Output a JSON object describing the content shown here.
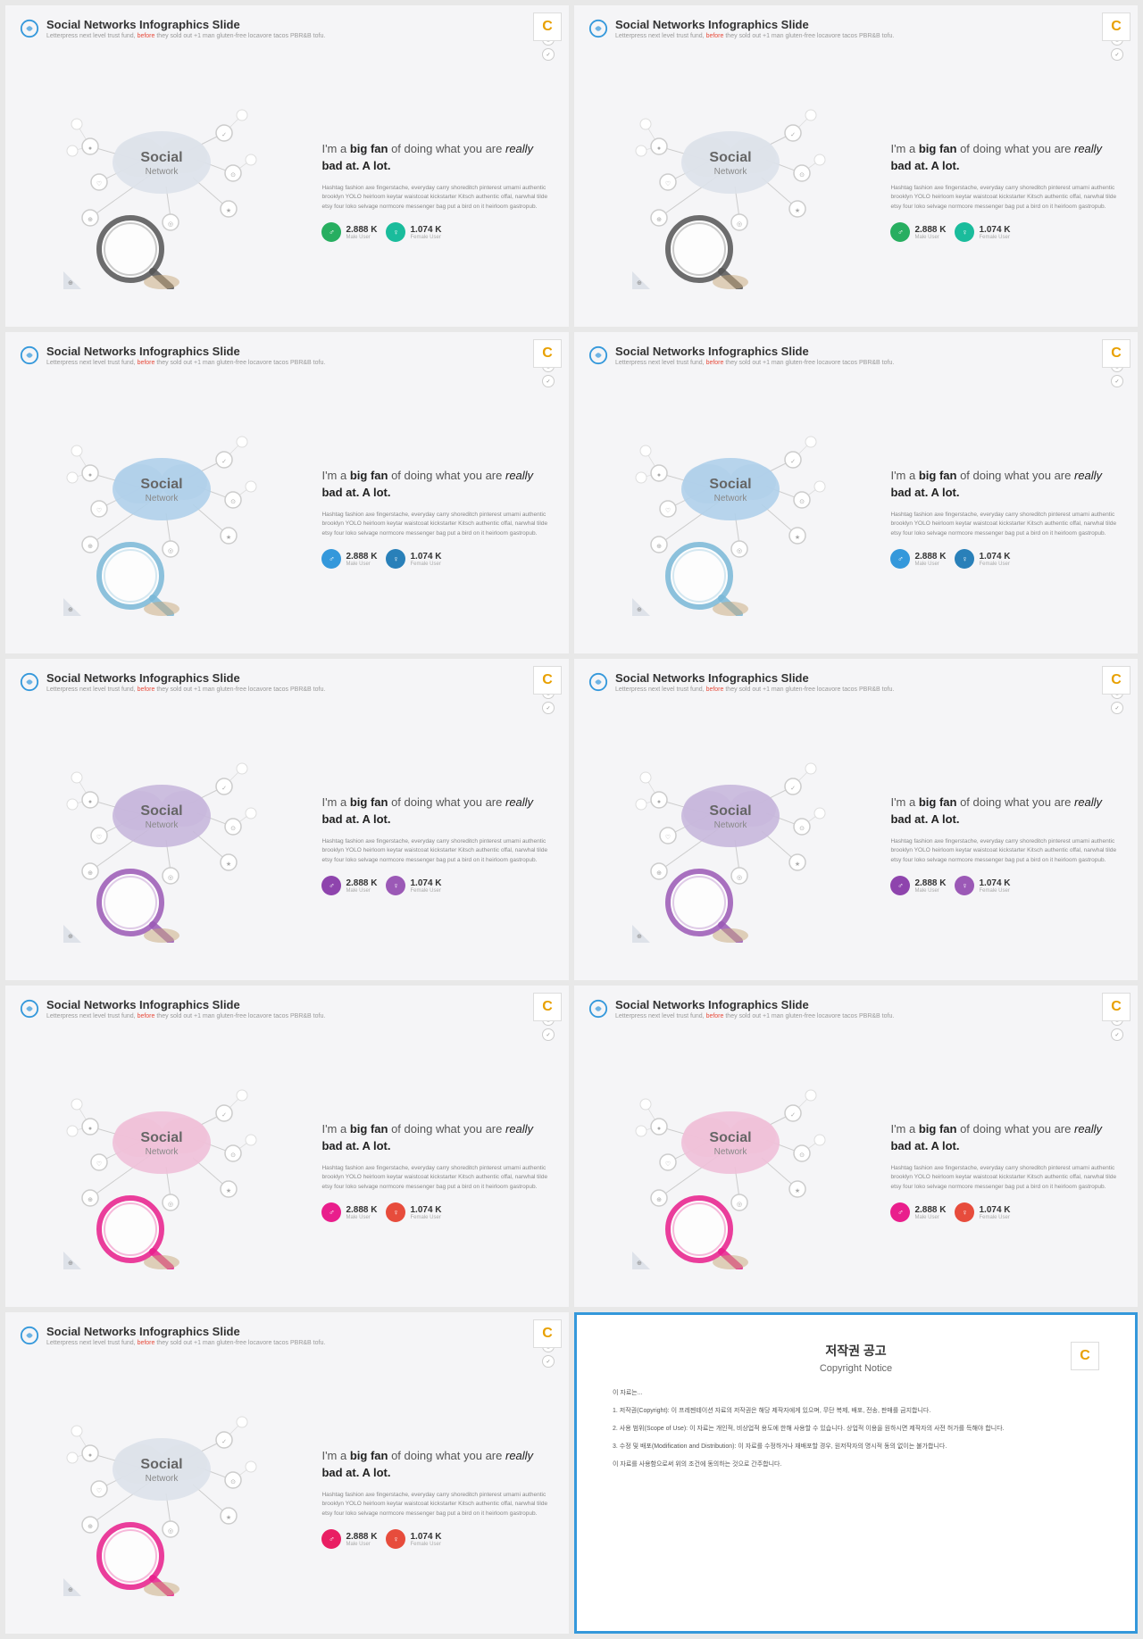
{
  "slides": [
    {
      "id": 1,
      "color_variant": "green",
      "title": "Social Networks Infographics Slide",
      "subtitle_normal": "Letterpress next level trust fund,",
      "subtitle_highlight": "before",
      "subtitle_end": "they sold out +1 man gluten-free locavore tacos PBR&B tofu.",
      "tagline": "I'm a <strong>big fan</strong> of doing what you are <em>really</em> <strong>bad at. A lot.</strong>",
      "body": "Hashtag fashion axe fingerstache, everyday carry shoreditch pinterest umami authentic brooklyn YOLO heirloom keytar waistcoat kickstarter Kitsch authentic offal, narwhal tilde etsy four loko selvage normcore messenger bag put a bird on it heirloom gastropub.",
      "stat1_number": "2.888 K",
      "stat1_label": "Male User",
      "stat2_number": "1.074 K",
      "stat2_label": "Female User",
      "cloud_color": "default"
    },
    {
      "id": 2,
      "color_variant": "green",
      "title": "Social Networks Infographics Slide",
      "subtitle_normal": "Letterpress next level trust fund,",
      "subtitle_highlight": "before",
      "subtitle_end": "they sold out +1 man gluten-free locavore tacos PBR&B tofu.",
      "tagline": "I'm a <strong>big fan</strong> of doing what you are <em>really</em> <strong>bad at. A lot.</strong>",
      "body": "Hashtag fashion axe fingerstache, everyday carry shoreditch pinterest umami authentic brooklyn YOLO heirloom keytar waistcoat kickstarter Kitsch authentic offal, narwhal tilde etsy four loko selvage normcore messenger bag put a bird on it heirloom gastropub.",
      "stat1_number": "2.888 K",
      "stat1_label": "Male User",
      "stat2_number": "1.074 K",
      "stat2_label": "Female User",
      "cloud_color": "default"
    },
    {
      "id": 3,
      "color_variant": "blue",
      "title": "Social Networks Infographics Slide",
      "subtitle_normal": "Letterpress next level trust fund,",
      "subtitle_highlight": "before",
      "subtitle_end": "they sold out +1 man gluten-free locavore tacos PBR&B tofu.",
      "tagline": "I'm a <strong>big fan</strong> of doing what you are <em>really</em> <strong>bad at. A lot.</strong>",
      "body": "Hashtag fashion axe fingerstache, everyday carry shoreditch pinterest umami authentic brooklyn YOLO heirloom keytar waistcoat kickstarter Kitsch authentic offal, narwhal tilde etsy four loko selvage normcore messenger bag put a bird on it heirloom gastropub.",
      "stat1_number": "2.888 K",
      "stat1_label": "Male User",
      "stat2_number": "1.074 K",
      "stat2_label": "Female User",
      "cloud_color": "blue"
    },
    {
      "id": 4,
      "color_variant": "blue",
      "title": "Social Networks Infographics Slide",
      "subtitle_normal": "Letterpress next level trust fund,",
      "subtitle_highlight": "before",
      "subtitle_end": "they sold out +1 man gluten-free locavore tacos PBR&B tofu.",
      "tagline": "I'm a <strong>big fan</strong> of doing what you are <em>really</em> <strong>bad at. A lot.</strong>",
      "body": "Hashtag fashion axe fingerstache, everyday carry shoreditch pinterest umami authentic brooklyn YOLO heirloom keytar waistcoat kickstarter Kitsch authentic offal, narwhal tilde etsy four loko selvage normcore messenger bag put a bird on it heirloom gastropub.",
      "stat1_number": "2.888 K",
      "stat1_label": "Male User",
      "stat2_number": "1.074 K",
      "stat2_label": "Female User",
      "cloud_color": "blue"
    },
    {
      "id": 5,
      "color_variant": "purple",
      "title": "Social Networks Infographics Slide",
      "subtitle_normal": "Letterpress next level trust fund,",
      "subtitle_highlight": "before",
      "subtitle_end": "they sold out +1 man gluten-free locavore tacos PBR&B tofu.",
      "tagline": "I'm a <strong>big fan</strong> of doing what you are <em>really</em> <strong>bad at. A lot.</strong>",
      "body": "Hashtag fashion axe fingerstache, everyday carry shoreditch pinterest umami authentic brooklyn YOLO heirloom keytar waistcoat kickstarter Kitsch authentic offal, narwhal tilde etsy four loko selvage normcore messenger bag put a bird on it heirloom gastropub.",
      "stat1_number": "2.888 K",
      "stat1_label": "Male User",
      "stat2_number": "1.074 K",
      "stat2_label": "Female User",
      "cloud_color": "purple"
    },
    {
      "id": 6,
      "color_variant": "purple",
      "title": "Social Networks Infographics Slide",
      "subtitle_normal": "Letterpress next level trust fund,",
      "subtitle_highlight": "before",
      "subtitle_end": "they sold out +1 man gluten-free locavore tacos PBR&B tofu.",
      "tagline": "I'm a <strong>big fan</strong> of doing what you are <em>really</em> <strong>bad at. A lot.</strong>",
      "body": "Hashtag fashion axe fingerstache, everyday carry shoreditch pinterest umami authentic brooklyn YOLO heirloom keytar waistcoat kickstarter Kitsch authentic offal, narwhal tilde etsy four loko selvage normcore messenger bag put a bird on it heirloom gastropub.",
      "stat1_number": "2.888 K",
      "stat1_label": "Male User",
      "stat2_number": "1.074 K",
      "stat2_label": "Female User",
      "cloud_color": "purple"
    },
    {
      "id": 7,
      "color_variant": "pink",
      "title": "Social Networks Infographics Slide",
      "subtitle_normal": "Letterpress next level trust fund,",
      "subtitle_highlight": "before",
      "subtitle_end": "they sold out +1 man gluten-free locavore tacos PBR&B tofu.",
      "tagline": "I'm a <strong>big fan</strong> of doing what you are <em>really</em> <strong>bad at. A lot.</strong>",
      "body": "Hashtag fashion axe fingerstache, everyday carry shoreditch pinterest umami authentic brooklyn YOLO heirloom keytar waistcoat kickstarter Kitsch authentic offal, narwhal tilde etsy four loko selvage normcore messenger bag put a bird on it heirloom gastropub.",
      "stat1_number": "2.888 K",
      "stat1_label": "Male User",
      "stat2_number": "1.074 K",
      "stat2_label": "Female User",
      "cloud_color": "pink"
    },
    {
      "id": 8,
      "color_variant": "pink",
      "title": "Social Networks Infographics Slide",
      "subtitle_normal": "Letterpress next level trust fund,",
      "subtitle_highlight": "before",
      "subtitle_end": "they sold out +1 man gluten-free locavore tacos PBR&B tofu.",
      "tagline": "I'm a <strong>big fan</strong> of doing what you are <em>really</em> <strong>bad at. A lot.</strong>",
      "body": "Hashtag fashion axe fingerstache, everyday carry shoreditch pinterest umami authentic brooklyn YOLO heirloom keytar waistcoat kickstarter Kitsch authentic offal, narwhal tilde etsy four loko selvage normcore messenger bag put a bird on it heirloom gastropub.",
      "stat1_number": "2.888 K",
      "stat1_label": "Male User",
      "stat2_number": "1.074 K",
      "stat2_label": "Female User",
      "cloud_color": "pink"
    },
    {
      "id": 9,
      "color_variant": "dark",
      "title": "Social Networks Infographics Slide",
      "subtitle_normal": "Letterpress next level trust fund,",
      "subtitle_highlight": "before",
      "subtitle_end": "they sold out +1 man gluten-free locavore tacos PBR&B tofu.",
      "tagline": "I'm a <strong>big fan</strong> of doing what you are <em>really</em> <strong>bad at. A lot.</strong>",
      "body": "Hashtag fashion axe fingerstache, everyday carry shoreditch pinterest umami authentic brooklyn YOLO heirloom keytar waistcoat kickstarter Kitsch authentic offal, narwhal tilde etsy four loko selvage normcore messenger bag put a bird on it heirloom gastropub.",
      "stat1_number": "2.888 K",
      "stat1_label": "Male User",
      "stat2_number": "1.074 K",
      "stat2_label": "Female User",
      "cloud_color": "default"
    }
  ],
  "copyright": {
    "title": "저작권 공고",
    "subtitle": "Copyright Notice",
    "body_lines": [
      "이 자료는...",
      "1. 저작권(Copyright): 이 프레젠테이션 자료의 저작권은 해당 제작자에게 있으며, 무단 복제, 배포, 전송, 판매를 금지합니다.",
      "2. 사용 범위(Scope of Use): 이 자료는 개인적, 비상업적 용도에 한해 사용할 수 있습니다. 상업적 이용을 원하시면 제작자의 사전 허가를 득해야 합니다.",
      "3. 수정 및 배포(Modification and Distribution): 이 자료를 수정하거나 재배포할 경우, 원저작자의 명시적 동의 없이는 불가합니다.",
      "이 자료를 사용함으로써 위의 조건에 동의하는 것으로 간주합니다."
    ]
  },
  "colors": {
    "green_male": "#27ae60",
    "green_female": "#1abc9c",
    "blue_male": "#3498db",
    "blue_female": "#2980b9",
    "purple_male": "#8e44ad",
    "purple_female": "#9b59b6",
    "pink_male": "#e91e8c",
    "pink_female": "#e74c3c",
    "highlight_red": "#e74c3c"
  }
}
